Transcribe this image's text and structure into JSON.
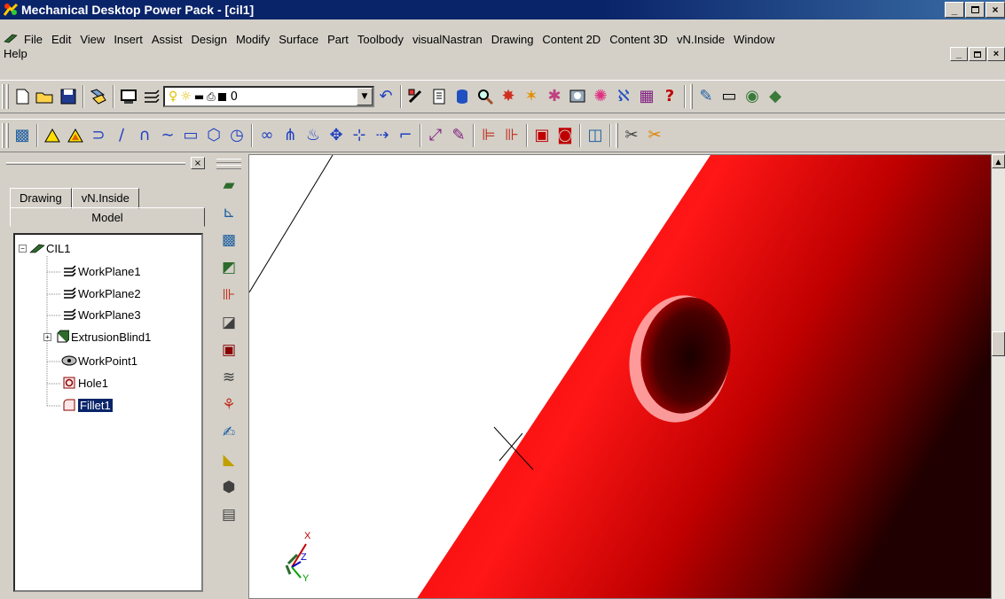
{
  "window": {
    "title": "Mechanical Desktop Power Pack - [cil1]",
    "minimize": "_",
    "restore": "▫",
    "close": "×"
  },
  "menu": {
    "items": [
      "File",
      "Edit",
      "View",
      "Insert",
      "Assist",
      "Design",
      "Modify",
      "Surface",
      "Part",
      "Toolbody",
      "visualNastran",
      "Drawing",
      "Content 2D",
      "Content 3D",
      "vN.Inside",
      "Window"
    ],
    "help": "Help"
  },
  "toolbar": {
    "layer_value": "0"
  },
  "panel": {
    "tabs": [
      "Drawing",
      "vN.Inside"
    ],
    "active_tab": "Model",
    "close": "×"
  },
  "tree": {
    "root": "CIL1",
    "items": [
      "WorkPlane1",
      "WorkPlane2",
      "WorkPlane3",
      "ExtrusionBlind1",
      "WorkPoint1",
      "Hole1",
      "Fillet1"
    ],
    "selected": "Fillet1"
  },
  "viewport": {
    "solid_color": "#e8080a",
    "hole_color": "#3a0000",
    "axis": {
      "x": "X",
      "y": "Y",
      "z": "Z"
    }
  }
}
